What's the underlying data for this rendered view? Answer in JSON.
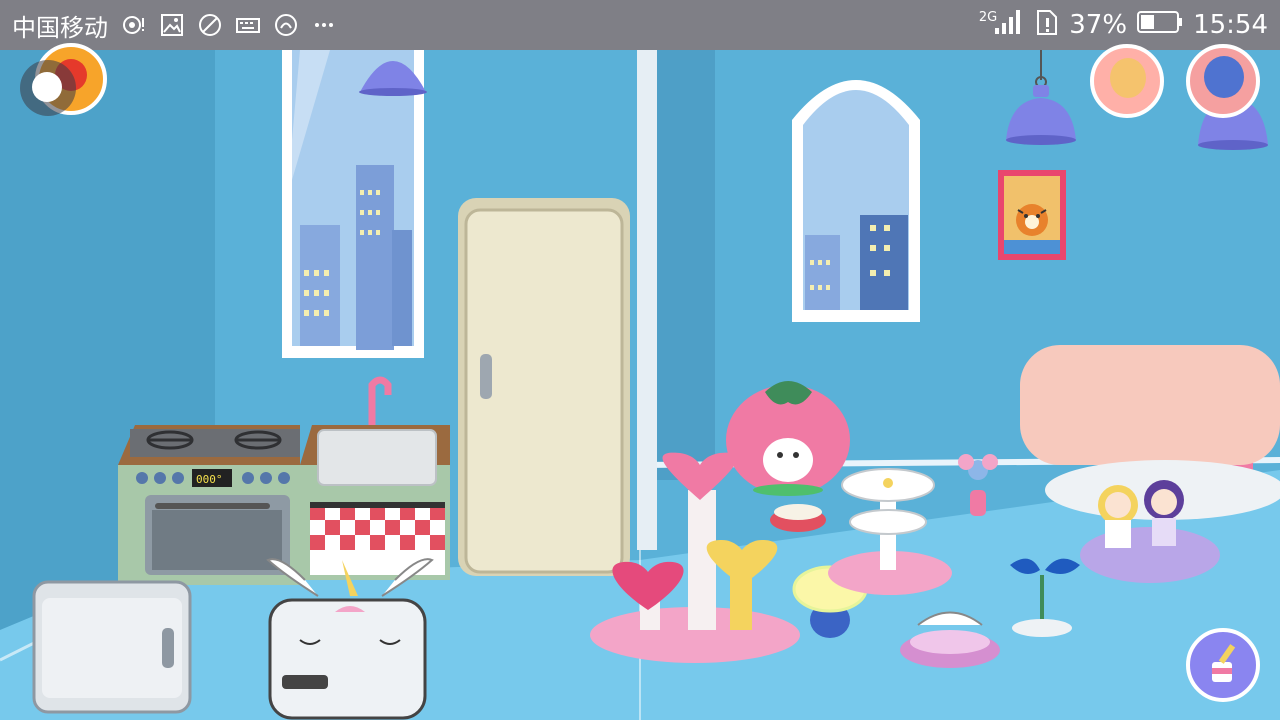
{
  "status_bar": {
    "carrier": "中国移动",
    "network": "2G",
    "battery_percent": "37%",
    "battery_level": 0.37,
    "time": "15:54",
    "notification_icons": [
      "hotspot-icon",
      "gallery-icon",
      "blocked-icon",
      "keyboard-icon",
      "app-icon",
      "more-icon"
    ]
  },
  "scene": {
    "room": "kitchen",
    "framed_picture": "tiger",
    "stove_display": "000°",
    "characters": [
      "bald-baby-avatar",
      "blue-hair-girl-avatar"
    ]
  },
  "colors": {
    "status_bar": "#7f7f86",
    "wall": "#5ab1d8",
    "floor": "#77c9ec",
    "fridge": "#ede8cf",
    "accent_pink": "#f07aa4",
    "lamp": "#7f83e6"
  }
}
